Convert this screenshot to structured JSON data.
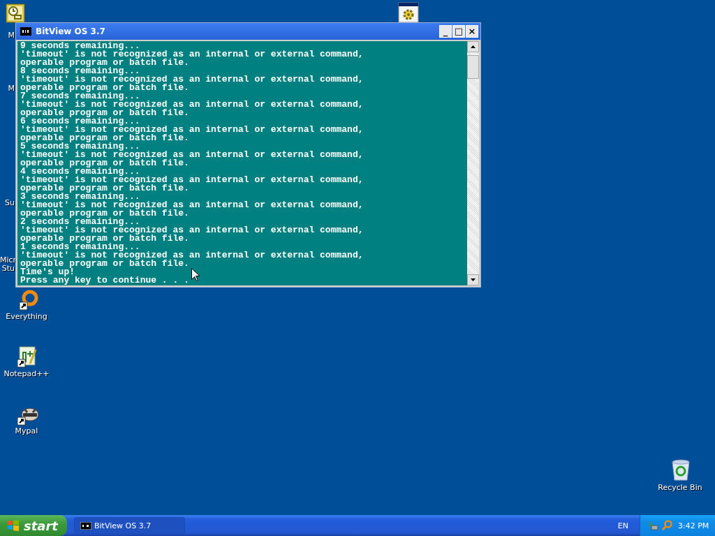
{
  "desktop_icons": [
    {
      "kind": "icon",
      "label": "M"
    },
    {
      "kind": "hidden",
      "label": "M"
    },
    {
      "kind": "hidden",
      "label": "Su"
    },
    {
      "kind": "hidden",
      "label": "Micr\nStu"
    },
    {
      "kind": "icon"
    },
    {
      "kind": "icon",
      "label": "Everything"
    },
    {
      "kind": "icon",
      "label": "Notepad++"
    },
    {
      "kind": "icon",
      "label": "Mypal"
    },
    {
      "kind": "icon",
      "label": "Recycle Bin"
    }
  ],
  "window": {
    "title": "BitView OS 3.7",
    "buttons": [
      "_",
      "□",
      "×"
    ],
    "lines": [
      "9 seconds remaining...",
      "'timeout' is not recognized as an internal or external command,",
      "operable program or batch file.",
      "8 seconds remaining...",
      "'timeout' is not recognized as an internal or external command,",
      "operable program or batch file.",
      "7 seconds remaining...",
      "'timeout' is not recognized as an internal or external command,",
      "operable program or batch file.",
      "6 seconds remaining...",
      "'timeout' is not recognized as an internal or external command,",
      "operable program or batch file.",
      "5 seconds remaining...",
      "'timeout' is not recognized as an internal or external command,",
      "operable program or batch file.",
      "4 seconds remaining...",
      "'timeout' is not recognized as an internal or external command,",
      "operable program or batch file.",
      "3 seconds remaining...",
      "'timeout' is not recognized as an internal or external command,",
      "operable program or batch file.",
      "2 seconds remaining...",
      "'timeout' is not recognized as an internal or external command,",
      "operable program or batch file.",
      "1 seconds remaining...",
      "'timeout' is not recognized as an internal or external command,",
      "operable program or batch file.",
      "Time's up!",
      "Press any key to continue . . ."
    ]
  },
  "taskbar": {
    "start": "start",
    "tasks": [
      {
        "label": "BitView OS 3.7",
        "selected": true
      }
    ],
    "language": "EN",
    "clock": "3:42 PM"
  }
}
